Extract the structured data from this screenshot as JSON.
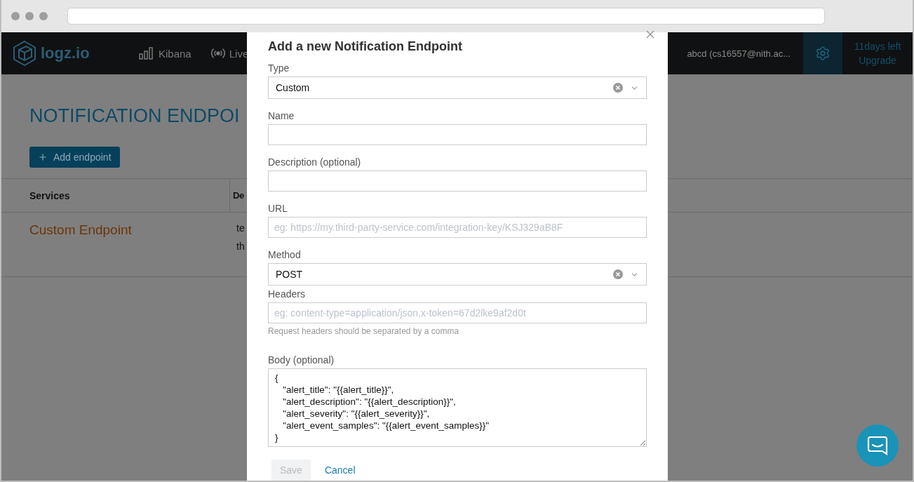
{
  "navbar": {
    "logo": "logz.io",
    "items": [
      {
        "label": "Kibana",
        "kind": "bars"
      },
      {
        "label": "Live",
        "kind": "broadcast"
      }
    ],
    "user": "abcd (cs16557@nith.ac...",
    "trial": "11days left",
    "upgrade": "Upgrade"
  },
  "page": {
    "title": "NOTIFICATION ENDPOI",
    "add_button": "Add endpoint",
    "columns": [
      "Services",
      "De"
    ],
    "rows": [
      {
        "service": "Custom Endpoint",
        "details": [
          "te",
          "th"
        ]
      }
    ]
  },
  "modal": {
    "title": "Add a new Notification Endpoint",
    "fields": [
      {
        "kind": "select",
        "label": "Type",
        "value": "Custom"
      },
      {
        "kind": "text",
        "label": "Name"
      },
      {
        "kind": "text",
        "label": "Description (optional)"
      },
      {
        "kind": "text",
        "label": "URL",
        "placeholder": "eg: https://my.third-party-service.com/integration-key/KSJ329aB8F"
      },
      {
        "kind": "select",
        "label": "Method",
        "value": "POST"
      },
      {
        "kind": "text",
        "label": "Headers",
        "placeholder": "eg: content-type=application/json,x-token=67d2lke9af2d0t",
        "hint": "Request headers should be separated by a comma"
      },
      {
        "kind": "textarea",
        "label": "Body (optional)",
        "value": "{\n   \"alert_title\": \"{{alert_title}}\",\n   \"alert_description\": \"{{alert_description}}\",\n   \"alert_severity\": \"{{alert_severity}}\",\n   \"alert_event_samples\": \"{{alert_event_samples}}\"\n}"
      }
    ],
    "save": {
      "label": "Save",
      "disabled": true
    },
    "cancel": "Cancel"
  }
}
